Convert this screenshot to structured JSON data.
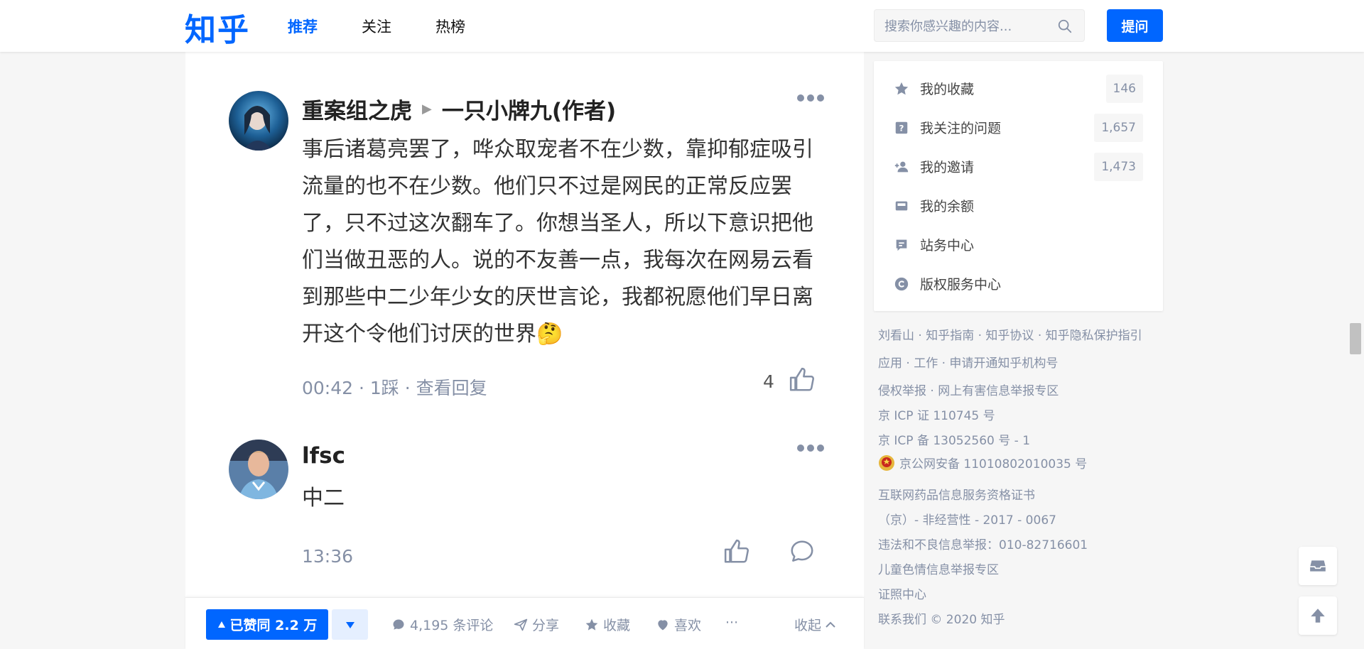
{
  "header": {
    "logo": "知乎",
    "tabs": [
      {
        "label": "推荐",
        "active": true
      },
      {
        "label": "关注",
        "active": false
      },
      {
        "label": "热榜",
        "active": false
      }
    ],
    "search_placeholder": "搜索你感兴趣的内容...",
    "ask_label": "提问"
  },
  "comments": [
    {
      "author": "重案组之虎",
      "reply_to": "一只小牌九(作者)",
      "text": "事后诸葛亮罢了，哗众取宠者不在少数，靠抑郁症吸引流量的也不在少数。他们只不过是网民的正常反应罢了，只不过这次翻车了。你想当圣人，所以下意识把他们当做丑恶的人。说的不友善一点，我每次在网易云看到那些中二少年少女的厌世言论，我都祝愿他们早日离开这个令他们讨厌的世界🤔",
      "time": "00:42",
      "dislike": "· 1踩",
      "view_replies": "· 查看回复",
      "likes": "4"
    },
    {
      "author": "lfsc",
      "text": "中二",
      "time": "13:36"
    }
  ],
  "actionbar": {
    "vote_label": "已赞同 2.2 万",
    "comments_label": "4,195 条评论",
    "share_label": "分享",
    "collect_label": "收藏",
    "like_label": "喜欢",
    "more_label": "···",
    "collapse_label": "收起"
  },
  "sidebar": {
    "items": [
      {
        "label": "我的收藏",
        "count": "146",
        "icon": "star-icon"
      },
      {
        "label": "我关注的问题",
        "count": "1,657",
        "icon": "question-icon"
      },
      {
        "label": "我的邀请",
        "count": "1,473",
        "icon": "invite-icon"
      },
      {
        "label": "我的余额",
        "count": "",
        "icon": "wallet-icon"
      },
      {
        "label": "站务中心",
        "count": "",
        "icon": "site-center-icon"
      },
      {
        "label": "版权服务中心",
        "count": "",
        "icon": "copyright-icon"
      }
    ]
  },
  "footer": {
    "links_row1": "刘看山 · 知乎指南 · 知乎协议 · 知乎隐私保护指引",
    "links_row2": "应用 · 工作 · 申请开通知乎机构号",
    "links_row3": "侵权举报 · 网上有害信息举报专区",
    "icp1": "京 ICP 证 110745 号",
    "icp2": "京 ICP 备 13052560 号 - 1",
    "police": "京公网安备 11010802010035 号",
    "drug1": "互联网药品信息服务资格证书",
    "drug2": "（京）- 非经营性 - 2017 - 0067",
    "report": "违法和不良信息举报：010-82716601",
    "child": "儿童色情信息举报专区",
    "license": "证照中心",
    "contact": "联系我们 © 2020 知乎"
  },
  "colors": {
    "brand": "#0066ff",
    "text_secondary": "#8590a6",
    "background": "#f6f6f6"
  }
}
